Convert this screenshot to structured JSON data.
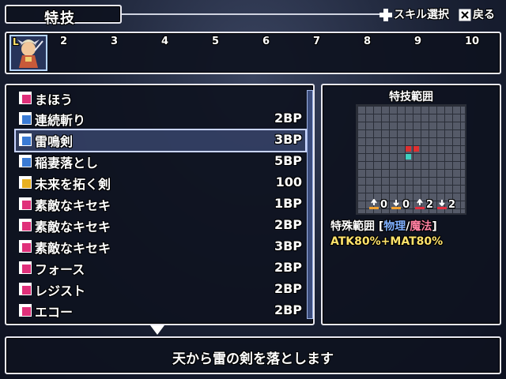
{
  "header": {
    "title": "特技",
    "hints": [
      {
        "icon": "dpad-icon",
        "label": "スキル選択"
      },
      {
        "icon": "cancel-key-icon",
        "label": "戻る"
      }
    ]
  },
  "party": {
    "slot1_marker": "L",
    "slot_numbers": [
      "2",
      "3",
      "4",
      "5",
      "6",
      "7",
      "8",
      "9",
      "10"
    ]
  },
  "skills": [
    {
      "name": "まほう",
      "cost": "",
      "icon": "magic-category-icon",
      "color": "#e0307a"
    },
    {
      "name": "連続斬り",
      "cost": "2BP",
      "icon": "sword-skill-icon",
      "color": "#3a7bd5"
    },
    {
      "name": "雷鳴剣",
      "cost": "3BP",
      "icon": "sword-skill-icon",
      "color": "#3a7bd5"
    },
    {
      "name": "稲妻落とし",
      "cost": "5BP",
      "icon": "sword-skill-icon",
      "color": "#3a7bd5"
    },
    {
      "name": "未来を拓く剣",
      "cost": "100",
      "icon": "ultimate-skill-icon",
      "color": "#e8b020"
    },
    {
      "name": "素敵なキセキ",
      "cost": "1BP",
      "icon": "music-note-icon",
      "color": "#e0307a"
    },
    {
      "name": "素敵なキセキ",
      "cost": "2BP",
      "icon": "music-note-icon",
      "color": "#e0307a"
    },
    {
      "name": "素敵なキセキ",
      "cost": "3BP",
      "icon": "music-note-icon",
      "color": "#e0307a"
    },
    {
      "name": "フォース",
      "cost": "2BP",
      "icon": "vocal-skill-icon",
      "color": "#e0307a"
    },
    {
      "name": "レジスト",
      "cost": "2BP",
      "icon": "vocal-skill-icon",
      "color": "#e0307a"
    },
    {
      "name": "エコー",
      "cost": "2BP",
      "icon": "vocal-skill-icon",
      "color": "#e0307a"
    }
  ],
  "selected_index": 2,
  "range": {
    "title": "特技範囲",
    "elements": [
      {
        "icon": "fire-element-icon",
        "value": "0"
      },
      {
        "icon": "water-element-icon",
        "value": "0"
      },
      {
        "icon": "wind-element-icon",
        "value": "2"
      },
      {
        "icon": "earth-element-icon",
        "value": "2"
      }
    ],
    "type_label": "特殊範囲",
    "bracket_open": "[",
    "physical": "物理",
    "separator": "/",
    "magic": "魔法",
    "bracket_close": "]",
    "formula": "ATK80%+MAT80%",
    "colors": {
      "target": "#e03030",
      "user": "#40d0c0",
      "physical": "#7fb0ff",
      "magic": "#ff7fa0"
    }
  },
  "description": "天から雷の剣を落とします"
}
